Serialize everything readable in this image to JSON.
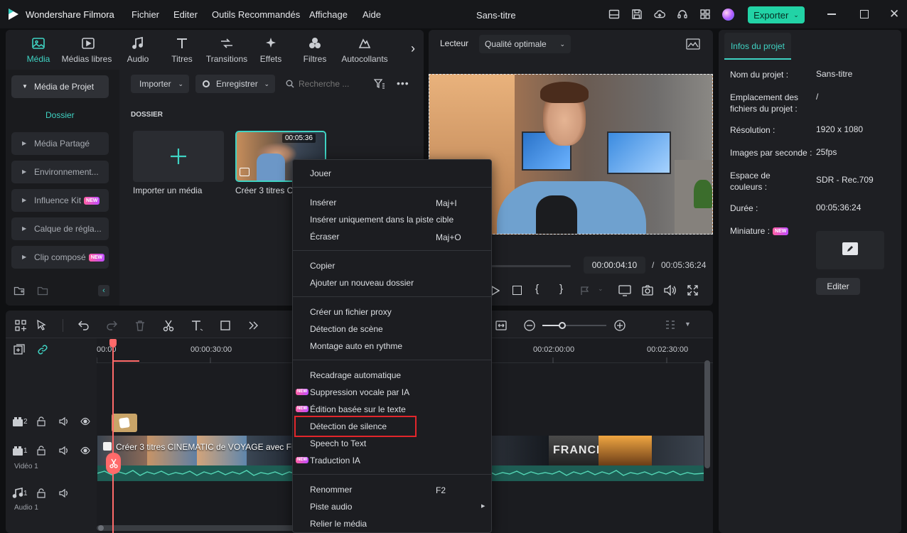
{
  "app": {
    "name": "Wondershare Filmora",
    "doc_title": "Sans-titre",
    "export_label": "Exporter"
  },
  "menu": [
    "Fichier",
    "Editer",
    "Outils Recommandés",
    "Affichage",
    "Aide"
  ],
  "toolbar": [
    {
      "label": "Média",
      "icon": "media-icon"
    },
    {
      "label": "Médias libres",
      "icon": "stock-media-icon"
    },
    {
      "label": "Audio",
      "icon": "music-note-icon"
    },
    {
      "label": "Titres",
      "icon": "text-icon"
    },
    {
      "label": "Transitions",
      "icon": "transitions-icon"
    },
    {
      "label": "Effets",
      "icon": "effects-icon"
    },
    {
      "label": "Filtres",
      "icon": "filters-icon"
    },
    {
      "label": "Autocollants",
      "icon": "stickers-icon"
    }
  ],
  "sidebar": {
    "project_media": "Média de Projet",
    "folder": "Dossier",
    "items": [
      "Média Partagé",
      "Environnement...",
      "Influence Kit",
      "Calque de régla...",
      "Clip composé"
    ],
    "new_badge": "NEW"
  },
  "media": {
    "import_label": "Importer",
    "record_label": "Enregistrer",
    "search_placeholder": "Recherche ...",
    "section": "DOSSIER",
    "import_tile": "Importer un média",
    "clip_title": "Créer 3 titres CI",
    "clip_duration": "00:05:36"
  },
  "player": {
    "tab": "Lecteur",
    "quality": "Qualité optimale",
    "current_time": "00:00:04:10",
    "separator": "/",
    "total_time": "00:05:36:24"
  },
  "info": {
    "tab": "Infos du projet",
    "rows": [
      {
        "label": "Nom du projet :",
        "value": "Sans-titre"
      },
      {
        "label": "Emplacement des fichiers du projet :",
        "value": "/"
      },
      {
        "label": "Résolution :",
        "value": "1920 x 1080"
      },
      {
        "label": "Images par seconde :",
        "value": "25fps"
      },
      {
        "label": "Espace de couleurs :",
        "value": "SDR - Rec.709"
      },
      {
        "label": "Durée :",
        "value": "00:05:36:24"
      }
    ],
    "thumbnail_label": "Miniature :",
    "edit_button": "Editer"
  },
  "context_menu": {
    "items": [
      {
        "label": "Jouer"
      },
      {
        "label": "Insérer",
        "shortcut": "Maj+I"
      },
      {
        "label": "Insérer uniquement dans la piste cible"
      },
      {
        "label": "Écraser",
        "shortcut": "Maj+O"
      },
      {
        "label": "Copier"
      },
      {
        "label": "Ajouter un nouveau dossier"
      },
      {
        "label": "Créer un fichier proxy"
      },
      {
        "label": "Détection de scène"
      },
      {
        "label": "Montage auto en rythme"
      },
      {
        "label": "Recadrage automatique"
      },
      {
        "label": "Suppression vocale par IA",
        "new": true
      },
      {
        "label": "Édition basée sur le texte",
        "new": true
      },
      {
        "label": "Détection de silence",
        "highlight": true
      },
      {
        "label": "Speech to Text"
      },
      {
        "label": "Traduction IA",
        "new": true
      },
      {
        "label": "Renommer",
        "shortcut": "F2"
      },
      {
        "label": "Piste audio",
        "submenu": true
      },
      {
        "label": "Relier le média"
      }
    ]
  },
  "timeline": {
    "ruler": [
      "00:00",
      "00:00:30:00",
      "00:02:00:00",
      "00:02:30:00"
    ],
    "tracks": [
      {
        "num": "2",
        "label": ""
      },
      {
        "num": "1",
        "label": "Vidéo 1"
      },
      {
        "num": "1",
        "label": "Audio 1"
      }
    ],
    "clip_title": "Créer 3 titres CINEMATIC de VOYAGE avec Film",
    "france_text": "FRANCE"
  }
}
